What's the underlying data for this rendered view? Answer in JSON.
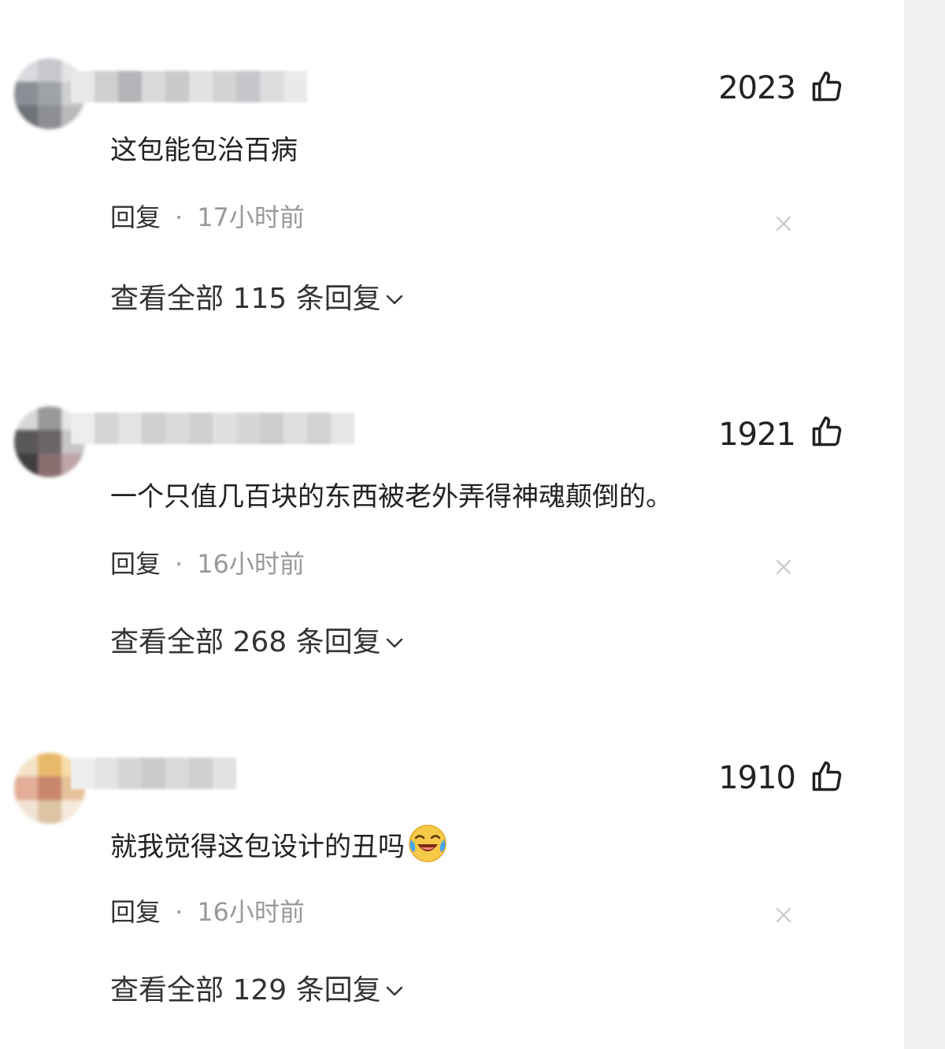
{
  "comments": [
    {
      "likes": "2023",
      "text": "这包能包治百病",
      "reply_label": "回复",
      "separator": "·",
      "time": "17小时前",
      "view_replies": "查看全部 115 条回复"
    },
    {
      "likes": "1921",
      "text": "一个只值几百块的东西被老外弄得神魂颠倒的。",
      "reply_label": "回复",
      "separator": "·",
      "time": "16小时前",
      "view_replies": "查看全部 268 条回复"
    },
    {
      "likes": "1910",
      "text": "就我觉得这包设计的丑吗",
      "emoji": "laughing-crying-emoji",
      "reply_label": "回复",
      "separator": "·",
      "time": "16小时前",
      "view_replies": "查看全部 129 条回复"
    }
  ],
  "icons": {
    "like": "thumbs-up-icon",
    "delete": "close-icon",
    "expand": "chevron-down-icon"
  },
  "colors": {
    "primary_text": "#222222",
    "secondary_text": "#999999",
    "scrollbar": "#f1f1f1"
  }
}
